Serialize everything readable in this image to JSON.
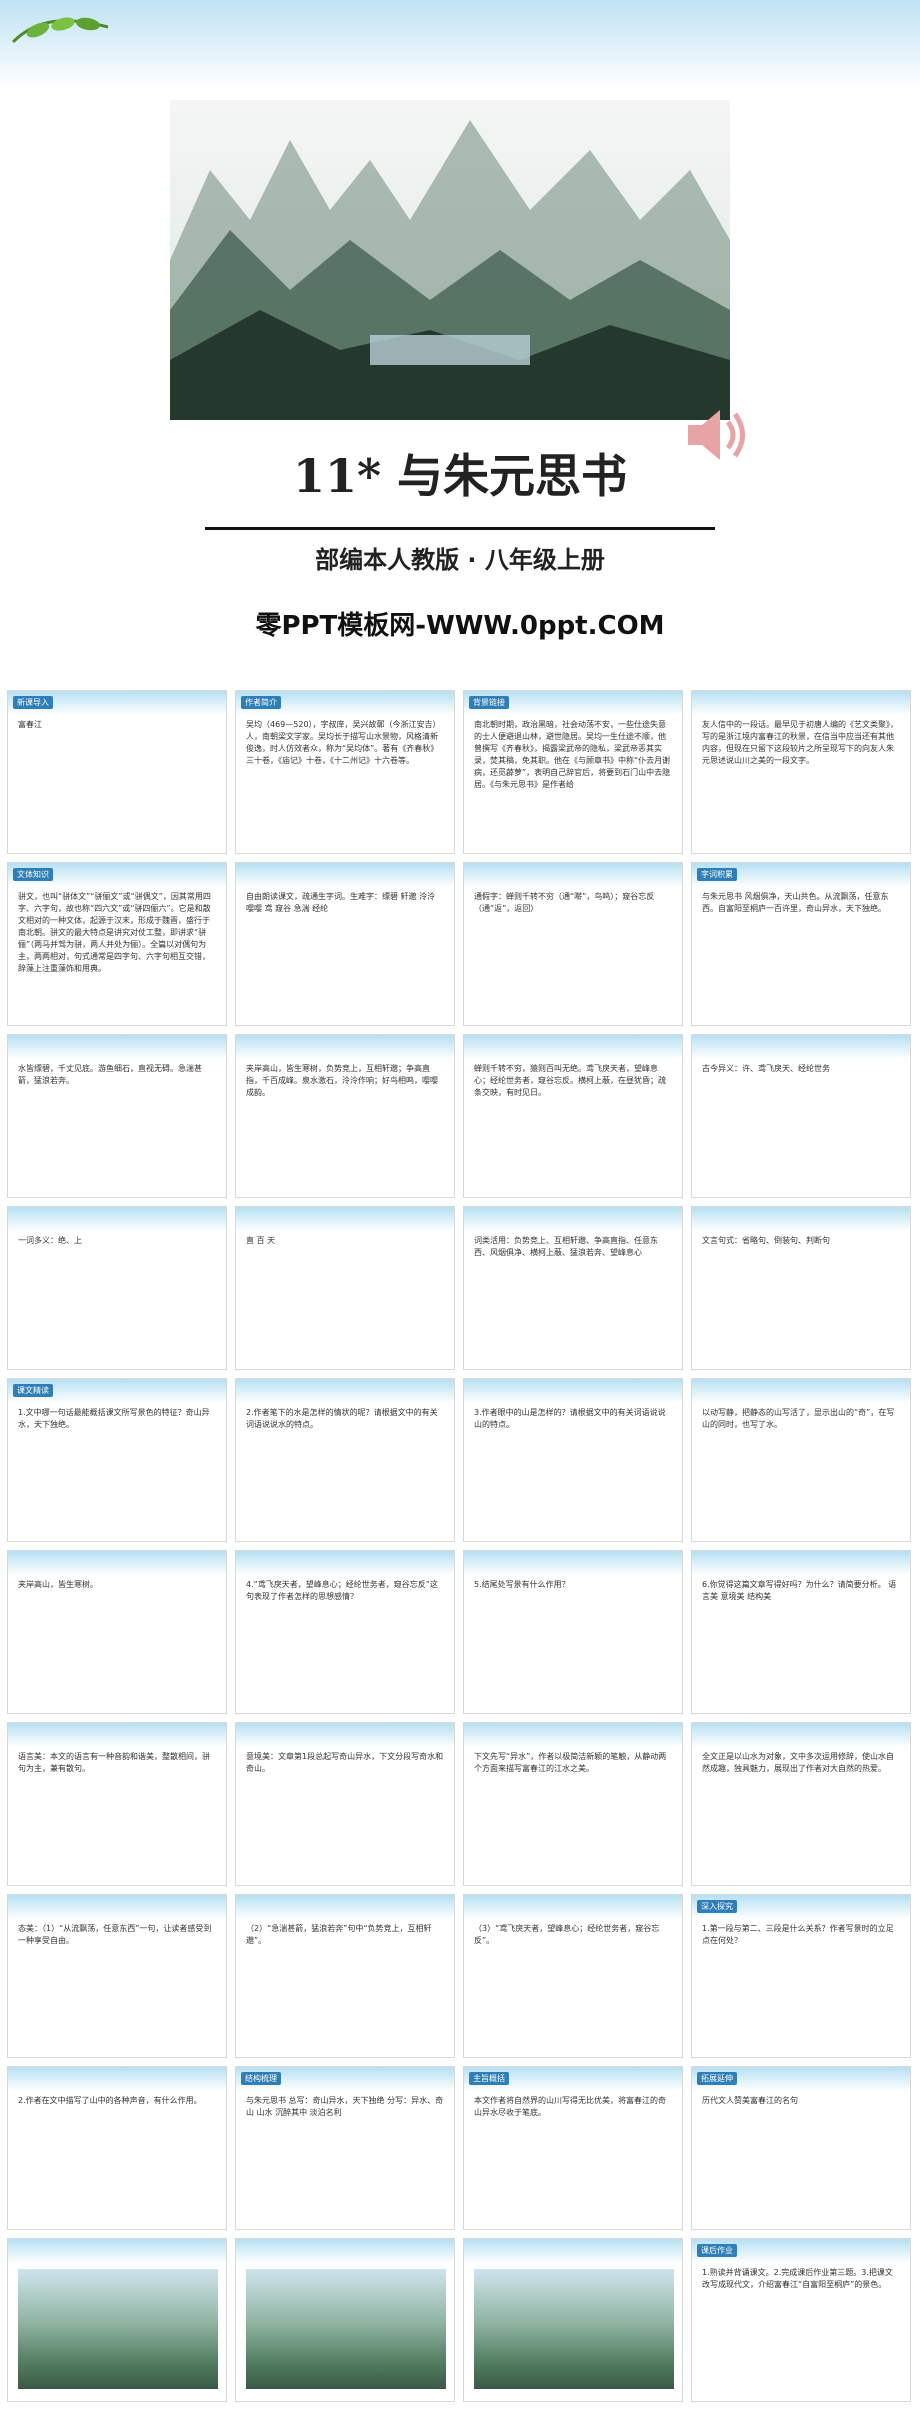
{
  "cover": {
    "title": "11*  与朱元思书",
    "subtitle": "部编本人教版 · 八年级上册",
    "site": "零PPT模板网-WWW.0ppt.COM"
  },
  "slides": [
    {
      "tag": "新课导入",
      "body": "富春江"
    },
    {
      "tag": "作者简介",
      "body": "吴均（469—520），字叔庠，吴兴故鄣（今浙江安吉）人，南朝梁文学家。吴均长于描写山水景物，风格清新俊逸，时人仿效者众，称为“吴均体”。著有《齐春秋》三十卷，《庙记》十卷，《十二州记》十六卷等。"
    },
    {
      "tag": "背景链接",
      "body": "南北朝时期，政治黑暗，社会动荡不安，一些仕途失意的士人便避退山林，避世隐居。吴均一生仕途不顺，他曾撰写《齐春秋》，揭露梁武帝的隐私，梁武帝恶其实录，焚其稿，免其职。他在《与顾章书》中称“仆去月谢病，还觅薜萝”，表明自己辞官后，将要到石门山中去隐居。《与朱元思书》是作者给"
    },
    {
      "tag": "",
      "body": "友人信中的一段话。最早见于初唐人编的《艺文类聚》，写的是浙江境内富春江的秋景，在信当中应当还有其他内容，但现在只留下这段较片之所呈现写下的向友人朱元思述说山川之美的一段文字。"
    },
    {
      "tag": "文体知识",
      "body": "骈文，也叫“骈体文”“骈俪文”或“骈偶文”，因其常用四字、六字句，故也称“四六文”或“骈四俪六”。它是和散文相对的一种文体，起源于汉末，形成于魏晋，盛行于南北朝。骈文的最大特点是讲究对仗工整，即讲求“骈俪”（两马并驾为骈，两人并处为俪）。全篇以对偶句为主，两两相对，句式通常是四字句、六字句相互交错，辞藻上注重藻饰和用典。"
    },
    {
      "tag": "",
      "body": "自由朗读课文，疏通生字词。生难字：缥碧 轩邈 泠泠 嘤嘤 鸢 窥谷 急湍 经纶"
    },
    {
      "tag": "",
      "body": "通假字：蝉则千转不穷（通“啭”，鸟鸣）；窥谷忘反（通“返”，返回）"
    },
    {
      "tag": "字词积累",
      "body": "与朱元思书  风烟俱净，天山共色。从流飘荡，任意东西。自富阳至桐庐一百许里，奇山异水，天下独绝。"
    },
    {
      "tag": "",
      "body": "水皆缥碧，千丈见底。游鱼细石，直视无碍。急湍甚箭，猛浪若奔。"
    },
    {
      "tag": "",
      "body": "夹岸高山，皆生寒树，负势竞上，互相轩邈；争高直指，千百成峰。泉水激石，泠泠作响；好鸟相鸣，嘤嘤成韵。"
    },
    {
      "tag": "",
      "body": "蝉则千转不穷，猿则百叫无绝。鸢飞戾天者，望峰息心；经纶世务者，窥谷忘反。横柯上蔽，在昼犹昏；疏条交映，有时见日。"
    },
    {
      "tag": "",
      "body": "古今异义：许、鸢飞戾天、经纶世务"
    },
    {
      "tag": "",
      "body": "一词多义：绝、上"
    },
    {
      "tag": "",
      "body": "直 百 天"
    },
    {
      "tag": "",
      "body": "词类活用：负势竞上、互相轩邈、争高直指、任意东西、风烟俱净、横柯上蔽、猛浪若奔、望峰息心"
    },
    {
      "tag": "",
      "body": "文言句式：省略句、倒装句、判断句"
    },
    {
      "tag": "课文精读",
      "body": "1.文中哪一句话最能概括课文所写景色的特征？奇山异水，天下独绝。"
    },
    {
      "tag": "",
      "body": "2.作者笔下的水是怎样的情状的呢？请根据文中的有关词语说说水的特点。"
    },
    {
      "tag": "",
      "body": "3.作者眼中的山是怎样的？请根据文中的有关词语说说山的特点。"
    },
    {
      "tag": "",
      "body": "以动写静，把静态的山写活了，显示出山的“奇”，在写山的同时，也写了水。"
    },
    {
      "tag": "",
      "body": "夹岸高山，皆生寒树。"
    },
    {
      "tag": "",
      "body": "4.“鸢飞戾天者，望峰息心；经纶世务者，窥谷忘反”这句表现了作者怎样的思想感情？"
    },
    {
      "tag": "",
      "body": "5.结尾处写景有什么作用？"
    },
    {
      "tag": "",
      "body": "6.你觉得这篇文章写得好吗？为什么？请简要分析。  语言美  意境美  结构美"
    },
    {
      "tag": "",
      "body": "语言美：本文的语言有一种音韵和谐美，整散相间，骈句为主，兼有散句。"
    },
    {
      "tag": "",
      "body": "意境美：文章第1段总起写奇山异水，下文分段写奇水和奇山。"
    },
    {
      "tag": "",
      "body": "下文先写“异水”，作者以极简洁新颖的笔触，从静动两个方面来描写富春江的江水之美。"
    },
    {
      "tag": "",
      "body": "全文正是以山水为对象，文中多次运用修辞，使山水自然成趣，独具魅力，展现出了作者对大自然的热爱。"
    },
    {
      "tag": "",
      "body": "态美：（1）“从流飘荡，任意东西”一句，让读者感受到一种享受自由。"
    },
    {
      "tag": "",
      "body": "（2）“急湍甚箭，猛浪若奔”句中“负势竞上，互相轩邈”。"
    },
    {
      "tag": "",
      "body": "（3）“鸢飞戾天者，望峰息心；经纶世务者，窥谷忘反”。"
    },
    {
      "tag": "深入探究",
      "body": "1.第一段与第二、三段是什么关系？作者写景时的立足点在何处？"
    },
    {
      "tag": "",
      "body": "2.作者在文中描写了山中的各种声音，有什么作用。"
    },
    {
      "tag": "结构梳理",
      "body": "与朱元思书  总写：奇山异水，天下独绝  分写：异水、奇山  山水 沉醉其中 淡泊名利"
    },
    {
      "tag": "主旨概括",
      "body": "本文作者将自然界的山川写得无比优美，将富春江的奇山异水尽收于笔底。"
    },
    {
      "tag": "拓展延伸",
      "body": "历代文人赞美富春江的名句"
    },
    {
      "tag": "",
      "body": ""
    },
    {
      "tag": "",
      "body": ""
    },
    {
      "tag": "",
      "body": ""
    },
    {
      "tag": "课后作业",
      "body": "1.熟读并背诵课文。2.完成课后作业第三题。3.把课文改写成现代文，介绍富春江“自富阳至桐庐”的景色。"
    }
  ]
}
